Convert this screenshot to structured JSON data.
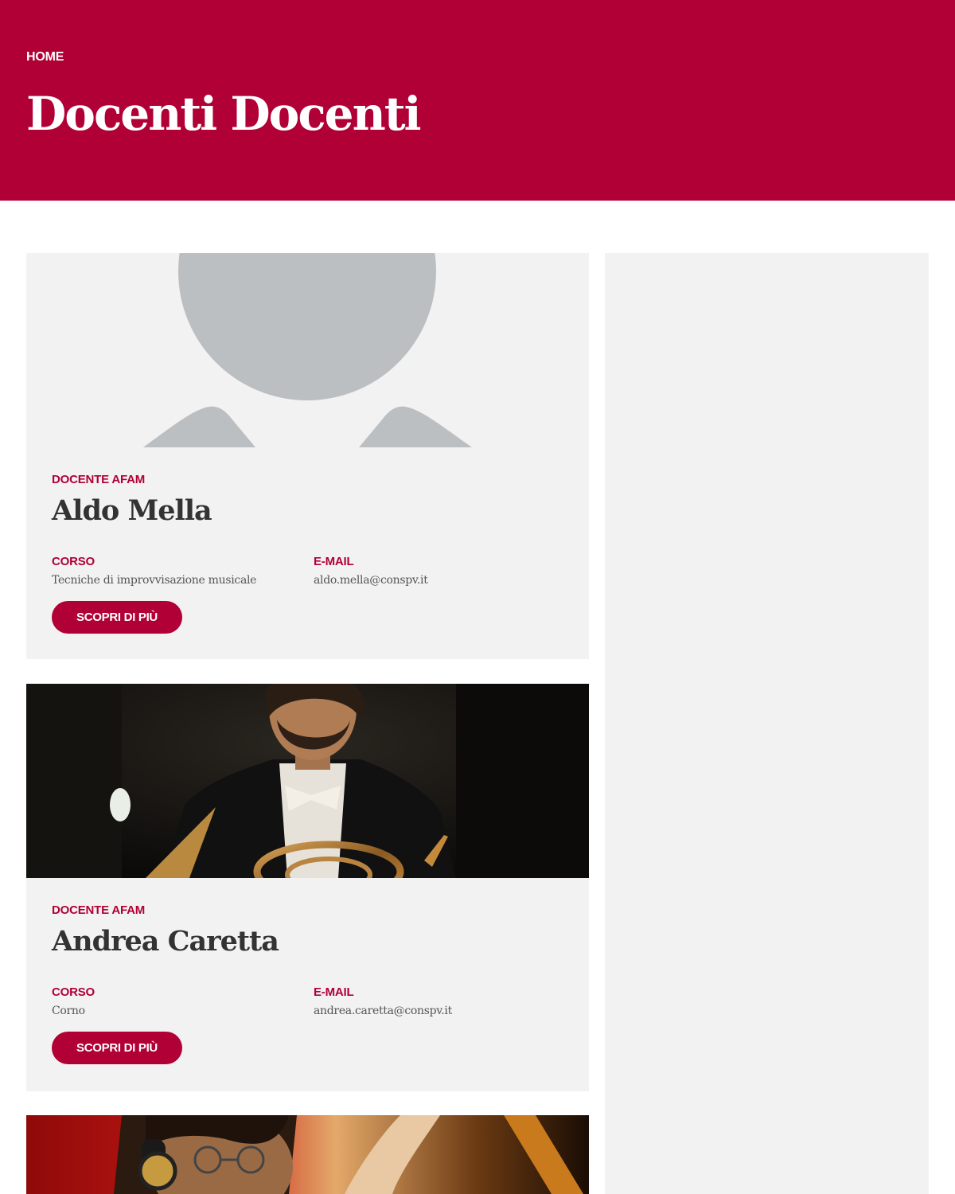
{
  "header": {
    "breadcrumb": "HOME",
    "title": "Docenti Docenti"
  },
  "colors": {
    "accent": "#b10036",
    "card_bg": "#f2f2f2",
    "placeholder_gray": "#bcbfc2"
  },
  "teachers": [
    {
      "role": "DOCENTE AFAM",
      "name": "Aldo Mella",
      "course_label": "CORSO",
      "course": "Tecniche di improvvisazione musicale",
      "email_label": "E-MAIL",
      "email": "aldo.mella@conspv.it",
      "button": "SCOPRI DI PIÙ",
      "image": "avatar-placeholder"
    },
    {
      "role": "DOCENTE AFAM",
      "name": "Andrea Caretta",
      "course_label": "CORSO",
      "course": "Corno",
      "email_label": "E-MAIL",
      "email": "andrea.caretta@conspv.it",
      "button": "SCOPRI DI PIÙ",
      "image": "photo-horn-player"
    },
    {
      "image": "photo-musician-headphones"
    }
  ]
}
